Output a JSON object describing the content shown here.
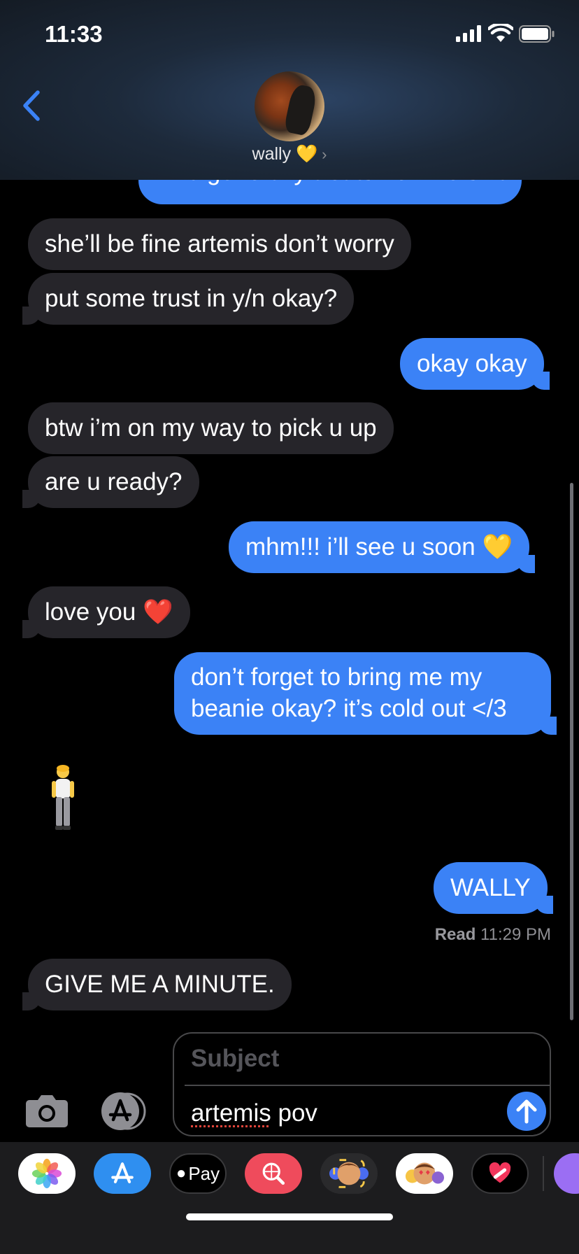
{
  "status_bar": {
    "time": "11:33"
  },
  "header": {
    "contact_name": "wally 💛",
    "chevron": "›"
  },
  "messages": [
    {
      "direction": "out",
      "text": "who generally treats her like shit"
    },
    {
      "direction": "in",
      "text": "she’ll be fine artemis don’t worry"
    },
    {
      "direction": "in",
      "text": "put some trust in y/n okay?"
    },
    {
      "direction": "out",
      "text": "okay okay"
    },
    {
      "direction": "in",
      "text": "btw i’m on my way to pick u up"
    },
    {
      "direction": "in",
      "text": "are u ready?"
    },
    {
      "direction": "out",
      "text": "mhm!!! i’ll see u soon 💛"
    },
    {
      "direction": "in",
      "text": "love you ❤️"
    },
    {
      "direction": "out",
      "text": "don’t forget to bring me my beanie okay? it’s cold out </3"
    },
    {
      "direction": "in",
      "text": "🧍‍♂️"
    },
    {
      "direction": "out",
      "text": "WALLY"
    },
    {
      "direction": "in",
      "text": "GIVE ME A MINUTE."
    }
  ],
  "read_receipt": {
    "label": "Read",
    "time": "11:29 PM"
  },
  "composer": {
    "subject_placeholder": "Subject",
    "text": "artemis",
    "text_rest": " pov"
  },
  "app_drawer": [
    {
      "name": "photos-icon"
    },
    {
      "name": "app-store-icon"
    },
    {
      "name": "apple-pay-icon",
      "label": "Pay"
    },
    {
      "name": "image-search-icon"
    },
    {
      "name": "memoji-icon"
    },
    {
      "name": "memoji-stickers-icon"
    },
    {
      "name": "digital-touch-icon"
    }
  ]
}
